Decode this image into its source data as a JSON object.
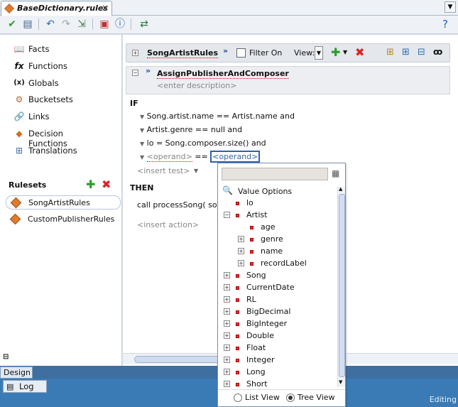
{
  "tab": {
    "title": "BaseDictionary.rules",
    "close": "×"
  },
  "left": {
    "nav": [
      {
        "label": "Facts",
        "icon": "facts-icon",
        "glyph": "📖"
      },
      {
        "label": "Functions",
        "icon": "functions-icon",
        "glyph": "fx"
      },
      {
        "label": "Globals",
        "icon": "globals-icon",
        "glyph": "(x)"
      },
      {
        "label": "Bucketsets",
        "icon": "bucketsets-icon",
        "glyph": "⚙"
      },
      {
        "label": "Links",
        "icon": "links-icon",
        "glyph": "🔗"
      },
      {
        "label": "Decision Functions",
        "icon": "decision-functions-icon",
        "glyph": "◆"
      },
      {
        "label": "Translations",
        "icon": "translations-icon",
        "glyph": "⊞"
      }
    ],
    "rulesets_label": "Rulesets",
    "rulesets": [
      "SongArtistRules",
      "CustomPublisherRules"
    ]
  },
  "ruleset": {
    "name": "SongArtistRules",
    "filter_label": "Filter On",
    "view_label": "View:"
  },
  "rule": {
    "name": "AssignPublisherAndComposer",
    "description": "<enter description>"
  },
  "if_label": "IF",
  "conditions": [
    {
      "lhs": "Song.artist.name",
      "op": "==",
      "rhs": "Artist.name",
      "conj": "and"
    },
    {
      "lhs": "Artist.genre",
      "op": "==",
      "rhs": "null",
      "conj": "and"
    },
    {
      "lhs": "lo",
      "op": "=",
      "rhs": "Song.composer.size()",
      "conj": "and"
    }
  ],
  "operand_left": "<operand>",
  "operand_op": "==",
  "operand_right": "<operand>",
  "insert_test": "<insert test>",
  "then_label": "THEN",
  "action": "call processSong( so",
  "insert_action": "<insert action>",
  "popup": {
    "header": "Value Options",
    "items": [
      {
        "label": "lo",
        "depth": 0,
        "exp": ""
      },
      {
        "label": "Artist",
        "depth": 0,
        "exp": "-"
      },
      {
        "label": "age",
        "depth": 1,
        "exp": ""
      },
      {
        "label": "genre",
        "depth": 1,
        "exp": "+"
      },
      {
        "label": "name",
        "depth": 1,
        "exp": "+"
      },
      {
        "label": "recordLabel",
        "depth": 1,
        "exp": "+"
      },
      {
        "label": "Song",
        "depth": 0,
        "exp": "+"
      },
      {
        "label": "CurrentDate",
        "depth": 0,
        "exp": "+"
      },
      {
        "label": "RL",
        "depth": 0,
        "exp": "+"
      },
      {
        "label": "BigDecimal",
        "depth": 0,
        "exp": "+"
      },
      {
        "label": "BigInteger",
        "depth": 0,
        "exp": "+"
      },
      {
        "label": "Double",
        "depth": 0,
        "exp": "+"
      },
      {
        "label": "Float",
        "depth": 0,
        "exp": "+"
      },
      {
        "label": "Integer",
        "depth": 0,
        "exp": "+"
      },
      {
        "label": "Long",
        "depth": 0,
        "exp": "+"
      },
      {
        "label": "Short",
        "depth": 0,
        "exp": "+"
      }
    ],
    "list_view": "List View",
    "tree_view": "Tree View"
  },
  "bottom": {
    "design_tab": "Design",
    "log_tab": "Log",
    "status": "Editing"
  }
}
